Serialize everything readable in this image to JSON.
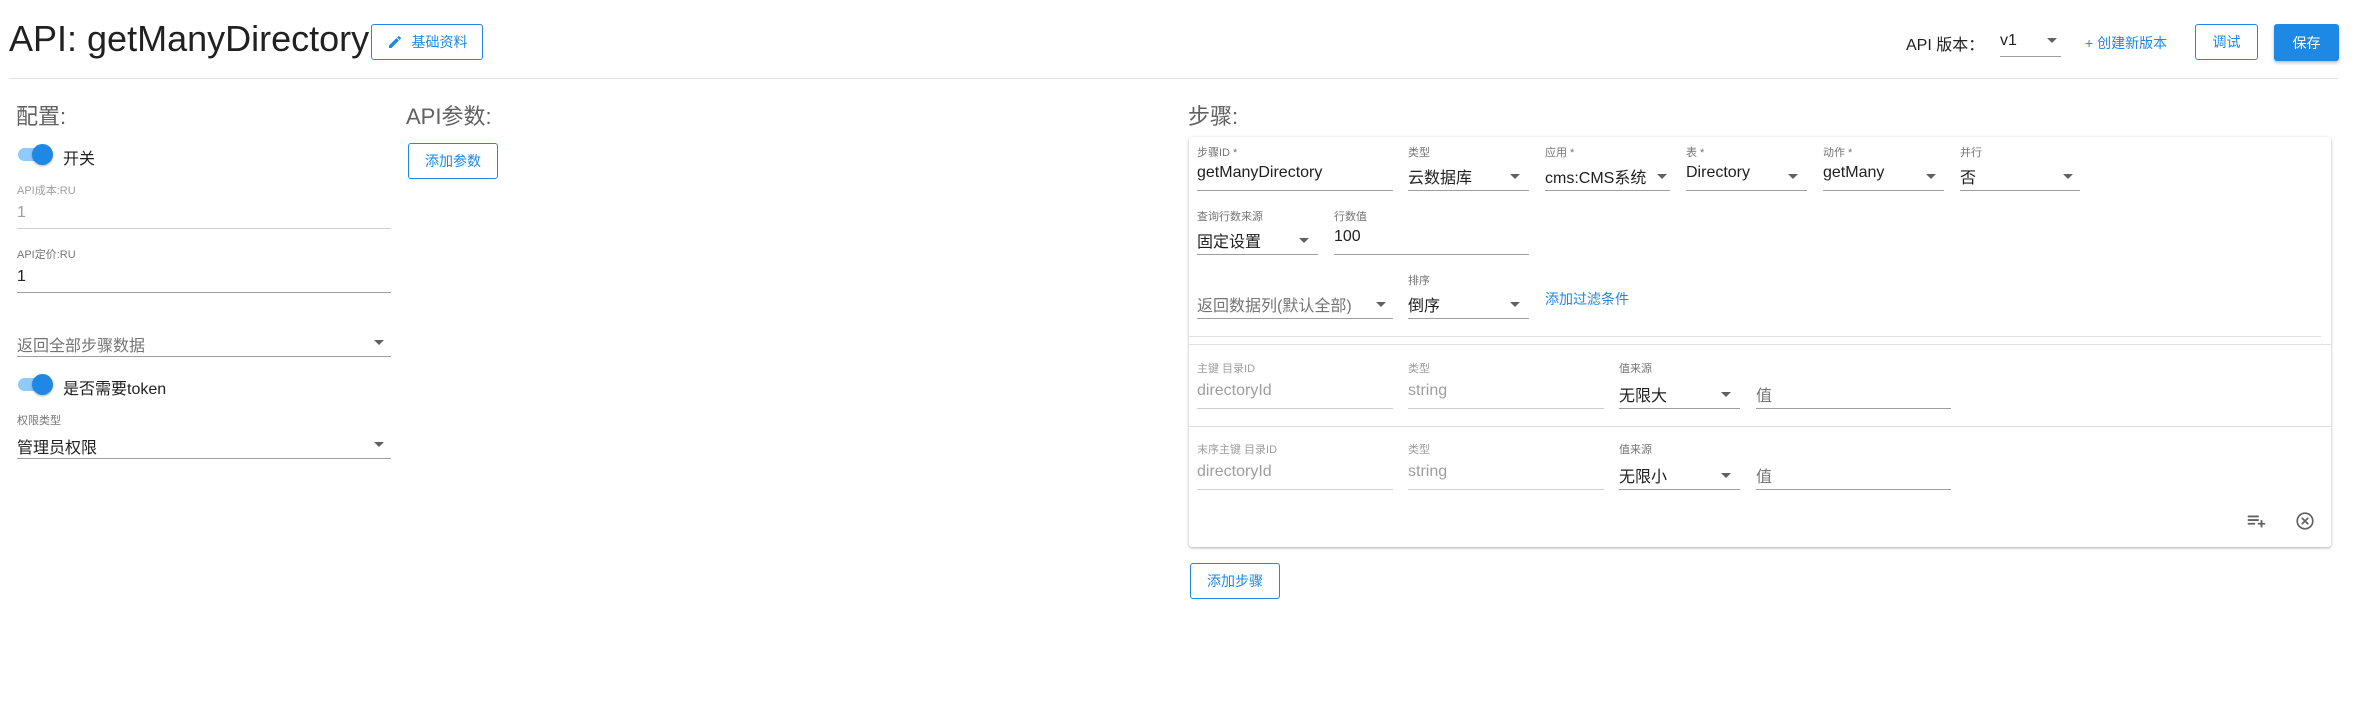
{
  "header": {
    "title": "API: getManyDirectory",
    "edit_label": "基础资料",
    "version_label": "API 版本：",
    "version_value": "v1",
    "new_version_label": "+ 创建新版本",
    "debug_label": "调试",
    "save_label": "保存"
  },
  "config": {
    "title": "配置:",
    "switch_label": "开关",
    "cost_label": "API成本:RU",
    "cost_value": "1",
    "price_label": "API定价:RU",
    "price_value": "1",
    "return_placeholder": "返回全部步骤数据",
    "token_label": "是否需要token",
    "perm_label": "权限类型",
    "perm_value": "管理员权限"
  },
  "params": {
    "title": "API参数:",
    "add_label": "添加参数"
  },
  "steps": {
    "title": "步骤:",
    "add_step_label": "添加步骤",
    "row1": {
      "step_id_label": "步骤ID *",
      "step_id_value": "getManyDirectory",
      "type_label": "类型",
      "type_value": "云数据库",
      "app_label": "应用 *",
      "app_value": "cms:CMS系统",
      "table_label": "表 *",
      "table_value": "Directory",
      "action_label": "动作 *",
      "action_value": "getMany",
      "parallel_label": "并行",
      "parallel_value": "否"
    },
    "row2": {
      "row_source_label": "查询行数来源",
      "row_source_value": "固定设置",
      "row_count_label": "行数值",
      "row_count_value": "100"
    },
    "row3": {
      "columns_placeholder": "返回数据列(默认全部)",
      "sort_label": "排序",
      "sort_value": "倒序",
      "add_filter_label": "添加过滤条件"
    },
    "keys": [
      {
        "key_label": "主键  目录ID",
        "key_value": "directoryId",
        "type_label": "类型",
        "type_value": "string",
        "source_label": "值来源",
        "source_value": "无限大",
        "value_placeholder": "值"
      },
      {
        "key_label": "末序主键  目录ID",
        "key_value": "directoryId",
        "type_label": "类型",
        "type_value": "string",
        "source_label": "值来源",
        "source_value": "无限小",
        "value_placeholder": "值"
      }
    ],
    "icons": {
      "add_row_icon": "playlist-add-icon",
      "remove_icon": "close-circle-icon"
    }
  },
  "colors": {
    "accent": "#1e88e5",
    "toggle_track": "#90caf9",
    "divider": "#e0e0e0"
  }
}
